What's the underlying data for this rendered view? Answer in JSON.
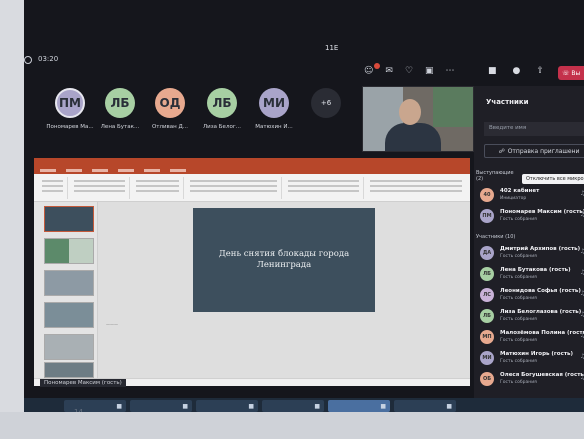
{
  "header": {
    "timer": "03:20",
    "meeting_title": "11E"
  },
  "participants_strip": [
    {
      "initials": "ПМ",
      "name": "Пономарев Ма...",
      "color": "#a9a4c9",
      "selected": true
    },
    {
      "initials": "ЛБ",
      "name": "Лена Бутак...",
      "color": "#a7cfa3"
    },
    {
      "initials": "ОД",
      "name": "Отливан Д...",
      "color": "#e7a98f"
    },
    {
      "initials": "ЛБ",
      "name": "Лиза Белог...",
      "color": "#a7cfa3"
    },
    {
      "initials": "МИ",
      "name": "Матюхин И...",
      "color": "#a9a4c9"
    }
  ],
  "more_count": "+6",
  "leave_label": "Вы",
  "panel": {
    "title": "Участники",
    "search_placeholder": "Введите имя",
    "invite_label": "Отправка приглашени",
    "presenters_section": "Выступающие (2)",
    "mute_all_label": "Отключить все микро",
    "attendees_section": "Участники (10)",
    "presenters": [
      {
        "initials": "40",
        "name": "402 кабинет",
        "role": "Инициатор",
        "color": "#e7a98f"
      },
      {
        "initials": "ПМ",
        "name": "Пономарев Максим (гость)",
        "role": "Гость собрания",
        "color": "#a9a4c9"
      }
    ],
    "attendees": [
      {
        "initials": "ДА",
        "name": "Дмитрий Архипов (гость)",
        "role": "Гость собрания",
        "color": "#a9a4c9"
      },
      {
        "initials": "ЛБ",
        "name": "Лена Бутакова (гость)",
        "role": "Гость собрания",
        "color": "#a7cfa3"
      },
      {
        "initials": "ЛС",
        "name": "Леонидова Софья (гость)",
        "role": "Гость собрания",
        "color": "#c9b2d8"
      },
      {
        "initials": "ЛБ",
        "name": "Лиза Белоглазова (гость)",
        "role": "Гость собрания",
        "color": "#a7cfa3"
      },
      {
        "initials": "МП",
        "name": "Малозёмова Полина (гость)",
        "role": "Гость собрания",
        "color": "#e7a98f"
      },
      {
        "initials": "МИ",
        "name": "Матюхин Игорь (гость)",
        "role": "Гость собрания",
        "color": "#a9a4c9"
      },
      {
        "initials": "ОБ",
        "name": "Олеся Богушевская (гость)",
        "role": "Гость собрания",
        "color": "#e7a98f"
      }
    ]
  },
  "slide": {
    "text": "День снятия блокады города Ленинграда"
  },
  "presenter_label": "Пономарев Максим (гость)",
  "taskbar": {
    "number": "14"
  },
  "colors": {
    "accent_red": "#c4314b",
    "ppt_ribbon": "#b7472a",
    "slide_bg": "#3d4f5d"
  }
}
